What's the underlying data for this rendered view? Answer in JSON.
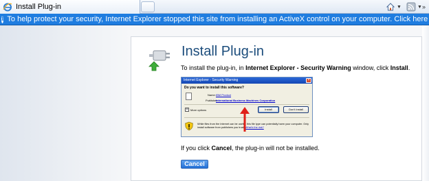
{
  "browser": {
    "tab_title": "Install Plug-in",
    "infobar_text": "To help protect your security, Internet Explorer stopped this site from installing an ActiveX control on your computer. Click here for options..."
  },
  "page": {
    "title": "Install Plug-in",
    "instruction_prefix": "To install the plug-in, in ",
    "instruction_bold1": "Internet Explorer - Security Warning",
    "instruction_mid": " window, click ",
    "instruction_bold2": "Install",
    "instruction_suffix": ".",
    "cancel_note_prefix": "If you click ",
    "cancel_note_bold": "Cancel",
    "cancel_note_suffix": ", the plug-in will not be installed.",
    "cancel_button": "Cancel"
  },
  "dialog": {
    "title": "Internet Explorer - Security Warning",
    "question": "Do you want to install this software?",
    "name_label": "Name:",
    "name_value": "IBM Product",
    "publisher_label": "Publisher:",
    "publisher_value": "International Business Machines Corporation",
    "more_options": "More options",
    "install_button": "Install",
    "dont_install_button": "Don't Install",
    "warning_text": "While files from the Internet can be useful, this file type can potentially harm your computer. Only install software from publishers you trust.",
    "risk_link": "What's the risk?"
  },
  "colors": {
    "infobar": "#1f7de0",
    "title": "#1c4d7c",
    "cancel_button": "#2470d6",
    "arrow": "#e0201a"
  },
  "icons": [
    "ie-logo-icon",
    "home-icon",
    "feed-icon",
    "plugin-icon",
    "shield-warning-icon",
    "info-icon"
  ]
}
